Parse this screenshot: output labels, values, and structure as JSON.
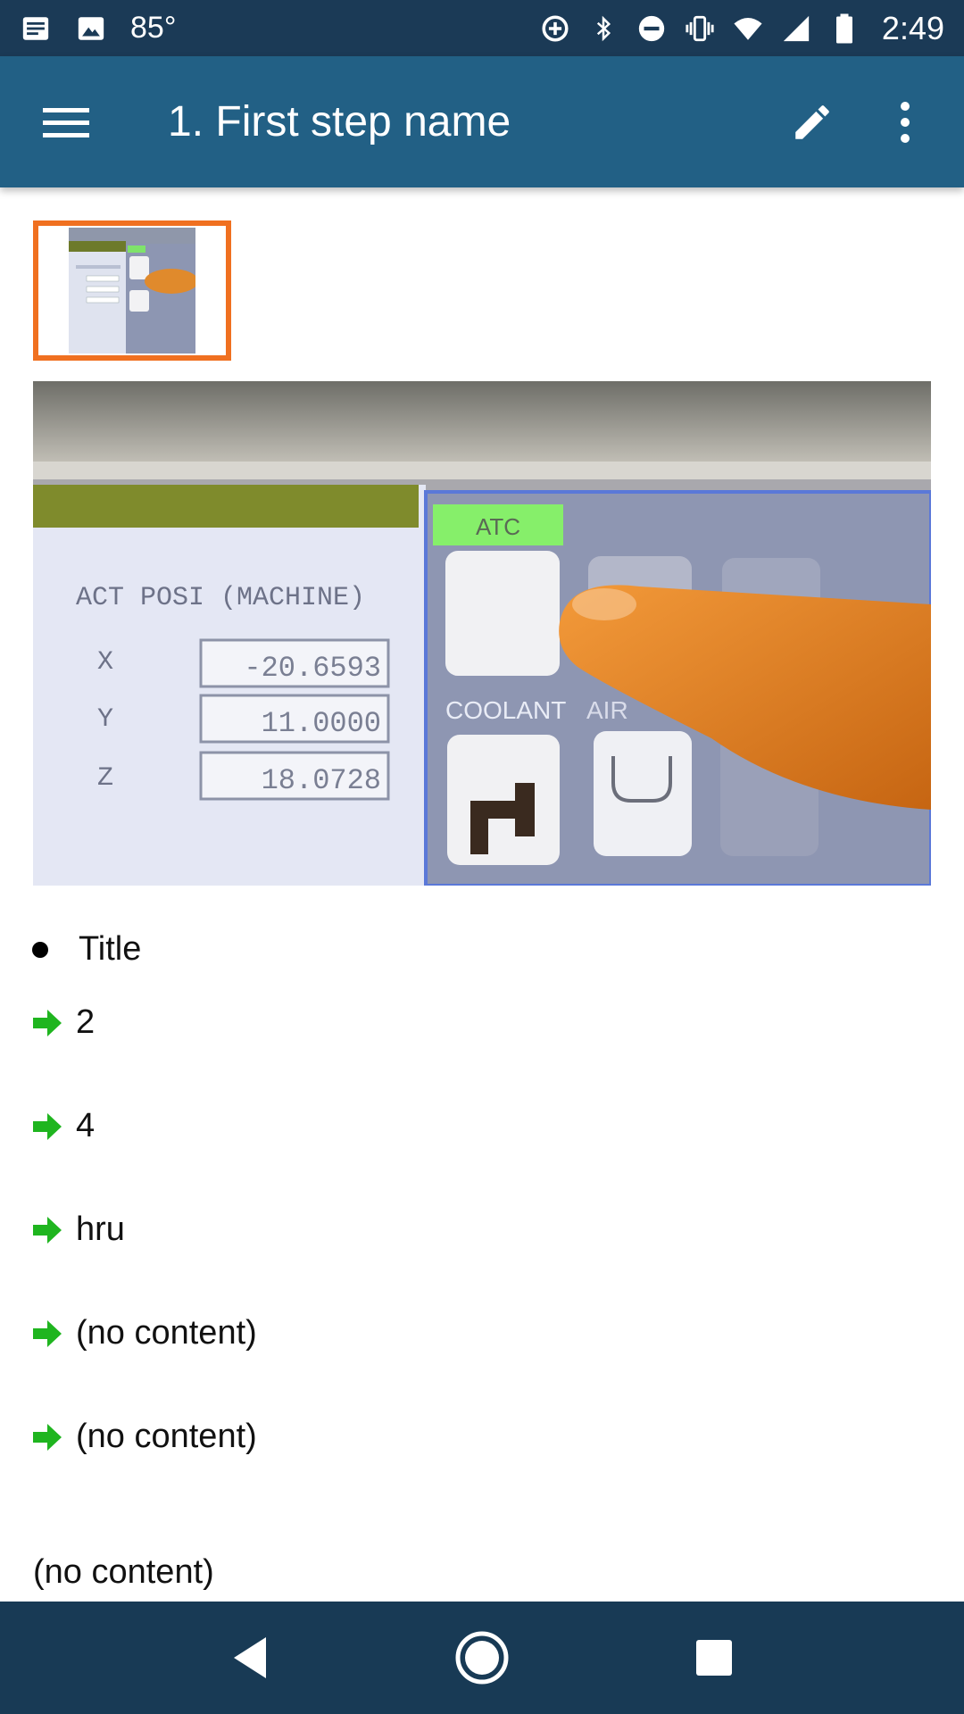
{
  "status_bar": {
    "temperature": "85°",
    "time": "2:49",
    "icons": [
      "notes-icon",
      "image-icon",
      "data-saver-icon",
      "bluetooth-icon",
      "do-not-disturb-icon",
      "vibrate-icon",
      "wifi-icon",
      "signal-icon",
      "battery-icon"
    ]
  },
  "app_bar": {
    "title": "1. First step name",
    "icons": [
      "menu-icon",
      "edit-icon",
      "more-vert-icon"
    ]
  },
  "content": {
    "bullet_title": "Title",
    "arrow_items": [
      "2",
      "4",
      "hru",
      "(no content)",
      "(no content)"
    ],
    "footer_text": "(no content)",
    "photo_labels": {
      "atc": "ATC",
      "act_posi": "ACT POSI (MACHINE)",
      "x_label": "X",
      "y_label": "Y",
      "z_label": "Z",
      "x_value": "-20.6593",
      "y_value": "11.0000",
      "z_value": "18.0728",
      "coolant": "COOLANT",
      "air": "AIR"
    }
  },
  "colors": {
    "status_bar": "#1b3a56",
    "app_bar": "#226085",
    "thumb_border": "#f07020",
    "arrow_green": "#1fb51f",
    "nav_bar": "#183a55"
  },
  "nav_bar": {
    "icons": [
      "back-icon",
      "home-icon",
      "recents-icon"
    ]
  }
}
